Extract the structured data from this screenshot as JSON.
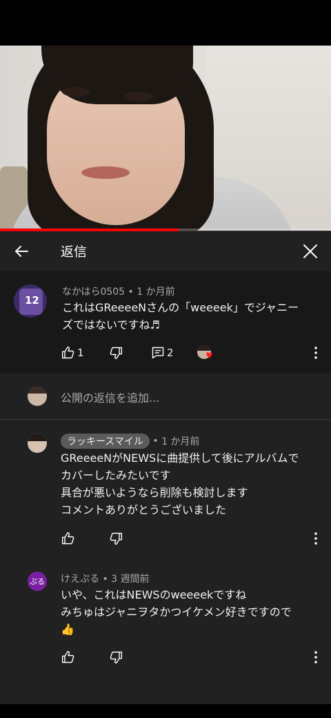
{
  "video": {
    "progress_percent": 54
  },
  "header": {
    "title": "返信",
    "back_icon": "arrow-left-icon",
    "close_icon": "close-icon"
  },
  "parent_comment": {
    "author": "なかはら0505",
    "time": "1 か月前",
    "text_line1": "これはGReeeeNさんの「weeeek」でジャニー",
    "text_line2": "ズではないですね♬",
    "avatar_text": "12",
    "likes": "1",
    "replies": "2"
  },
  "add_reply": {
    "placeholder": "公開の返信を追加..."
  },
  "replies": [
    {
      "author": "ラッキースマイル",
      "time": "1 か月前",
      "lines": [
        "GReeeeNがNEWSに曲提供して後にアルバムで",
        "カバーしたみたいです",
        "具合が悪いようなら削除も検討します",
        "コメントありがとうございました"
      ]
    },
    {
      "author": "けえぷる",
      "time": "3 週間前",
      "avatar_text": "ぷる",
      "avatar_color": "#7b1fa2",
      "lines": [
        "いや、これはNEWSのweeeekですね",
        "みちゅはジャニヲタかつイケメン好きですので"
      ],
      "emoji": "👍"
    }
  ],
  "colors": {
    "accent": "#ff0000",
    "panel": "#212121",
    "parent_bg": "#181818"
  }
}
